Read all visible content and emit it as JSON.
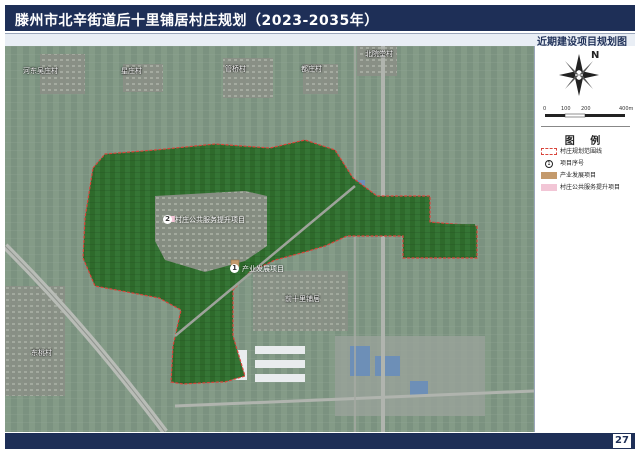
{
  "header": {
    "title": "滕州市北辛街道后十里铺居村庄规划（2023-2035年）",
    "subtitle": "近期建设项目规划图"
  },
  "map": {
    "places": [
      {
        "id": "beichuantai",
        "label": "北院堂村"
      },
      {
        "id": "hedongbeizhuang",
        "label": "河东吴庄村"
      },
      {
        "id": "xingzhuang",
        "label": "星庄村"
      },
      {
        "id": "guanqiao",
        "label": "管桥村"
      },
      {
        "id": "duzhuang",
        "label": "都庄村"
      },
      {
        "id": "qianshilipu",
        "label": "前十里铺居"
      },
      {
        "id": "dongbeicun",
        "label": "东桃村"
      }
    ],
    "projects": [
      {
        "number": "1",
        "label": "产业发展项目"
      },
      {
        "number": "2",
        "label": "村庄公共服务提升项目"
      }
    ]
  },
  "legend": {
    "north_label": "N",
    "scale_ticks": [
      "0",
      "100",
      "200",
      "400m"
    ],
    "title": "图  例",
    "items": [
      {
        "name": "boundary",
        "label": "村庄规划范围线",
        "swatch": "dashed-red"
      },
      {
        "name": "project-number",
        "label": "项目序号",
        "swatch": "circle-number",
        "symbol": "1"
      },
      {
        "name": "industry",
        "label": "产业发展项目",
        "swatch": "#c49a6c"
      },
      {
        "name": "public-service",
        "label": "村庄公共服务提升项目",
        "swatch": "#f2c6d6"
      }
    ]
  },
  "footer": {
    "page_number": "27"
  },
  "colors": {
    "header_bg": "#1e2f57",
    "boundary": "#d9443a",
    "planning_area": "#2f6b2a",
    "industry": "#c49a6c",
    "public_service": "#f2c6d6"
  }
}
